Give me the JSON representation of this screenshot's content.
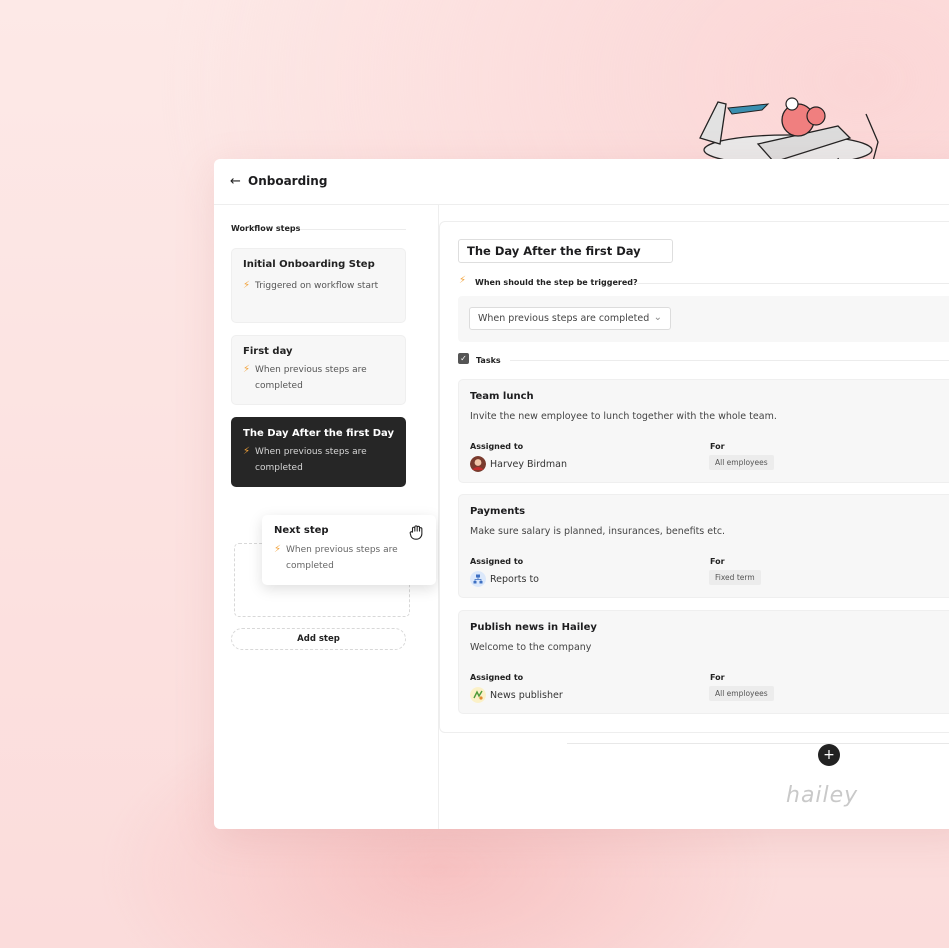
{
  "header": {
    "back_icon": "arrow-left-icon",
    "title": "Onboarding"
  },
  "sidebar": {
    "section_label": "Workflow steps",
    "steps": [
      {
        "name": "Initial Onboarding Step",
        "trigger": "Triggered on workflow start"
      },
      {
        "name": "First day",
        "trigger": "When previous steps are completed"
      },
      {
        "name": "The Day After the first Day",
        "trigger": "When previous steps are completed",
        "active": true
      }
    ],
    "dragging": {
      "name": "Next step",
      "trigger": "When previous steps are completed"
    },
    "add_step_label": "Add step"
  },
  "editor": {
    "step_name": "The Day After the first Day",
    "trigger_question": "When should the step be triggered?",
    "trigger_value": "When previous steps are completed",
    "tasks_label": "Tasks",
    "tasks": [
      {
        "title": "Team lunch",
        "description": "Invite the new employee to lunch together with the whole team.",
        "assigned_label": "Assigned to",
        "assignee": "Harvey Birdman",
        "for_label": "For",
        "for_value": "All employees"
      },
      {
        "title": "Payments",
        "description": "Make sure salary is planned, insurances, benefits etc.",
        "assigned_label": "Assigned to",
        "assignee": "Reports to",
        "for_label": "For",
        "for_value": "Fixed term"
      },
      {
        "title": "Publish news in Hailey",
        "description": "Welcome to the company",
        "assigned_label": "Assigned to",
        "assignee": "News publisher",
        "for_label": "For",
        "for_value": "All employees"
      }
    ]
  },
  "add_button_icon": "plus-icon",
  "logo_text": "hailey",
  "colors": {
    "accent_bolt": "#f2a23a",
    "active_step": "#262626",
    "background": "#fde9e7"
  }
}
